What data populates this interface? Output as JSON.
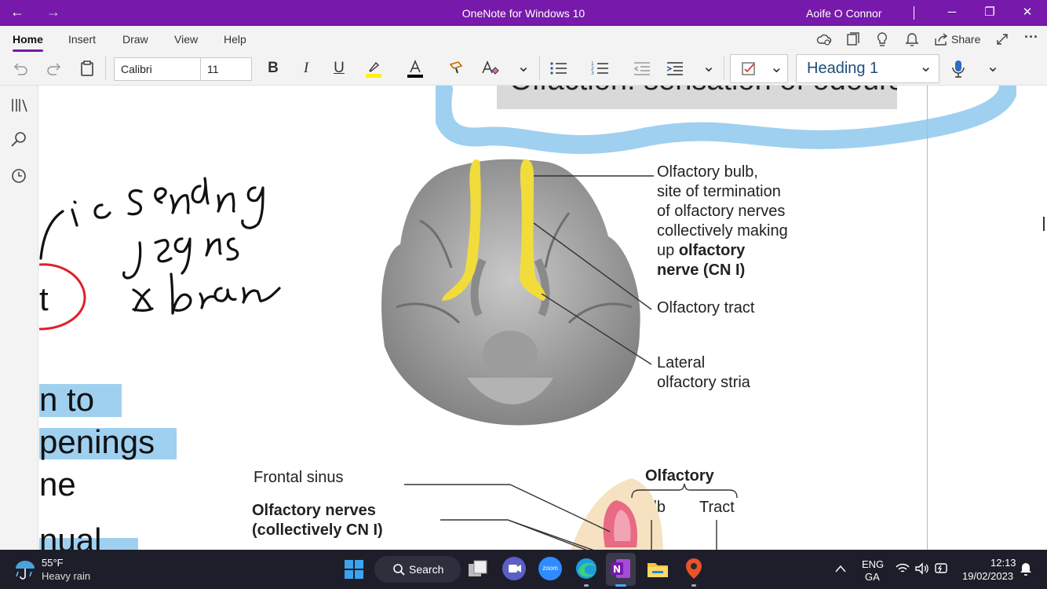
{
  "titlebar": {
    "title": "OneNote for Windows 10",
    "user": "Aoife O Connor",
    "back_glyph": "←",
    "forward_glyph": "→",
    "minimize_glyph": "─",
    "restore_glyph": "❐",
    "close_glyph": "✕"
  },
  "menu": {
    "tabs": [
      "Home",
      "Insert",
      "Draw",
      "View",
      "Help"
    ],
    "share_label": "Share",
    "more_glyph": "···"
  },
  "toolbar": {
    "font_name": "Calibri",
    "font_size": "11",
    "style": "Heading 1",
    "bold_glyph": "B",
    "italic_glyph": "I",
    "underline_glyph": "U",
    "highlight_color": "#fff200",
    "font_color": "#000000",
    "dropdown_glyph": "⌄"
  },
  "note": {
    "heading_partial": "Olfaction: sensation of odours",
    "ink_text": "ie sending signals to brain",
    "left_text": [
      "t",
      "n to",
      "penings",
      "ne",
      "nual"
    ],
    "figure1_labels": {
      "bulb": [
        "Olfactory bulb,",
        "site of termination",
        "of olfactory nerves",
        "collectively making"
      ],
      "bulb_line5_normal": "up ",
      "bulb_line5_bold": "olfactory",
      "bulb_line6_bold": "nerve (CN I)",
      "tract": "Olfactory tract",
      "stria": [
        "Lateral",
        "olfactory stria"
      ]
    },
    "figure2_labels": {
      "frontal_sinus": "Frontal sinus",
      "olfactory_nerves": [
        "Olfactory nerves",
        "(collectively CN I)"
      ],
      "olfactory": "Olfactory",
      "bulb": "Bulb",
      "tract": "Tract"
    }
  },
  "taskbar": {
    "temperature": "55°F",
    "weather": "Heavy rain",
    "search_label": "Search",
    "lang_top": "ENG",
    "lang_bottom": "GA",
    "time": "12:13",
    "date": "19/02/2023",
    "zoom_label": "zoom"
  },
  "colors": {
    "accent": "#7719aa",
    "highlight_blue": "#9fd0f0",
    "bulb_yellow": "#f2dc3c",
    "ink_red": "#e0202a"
  }
}
